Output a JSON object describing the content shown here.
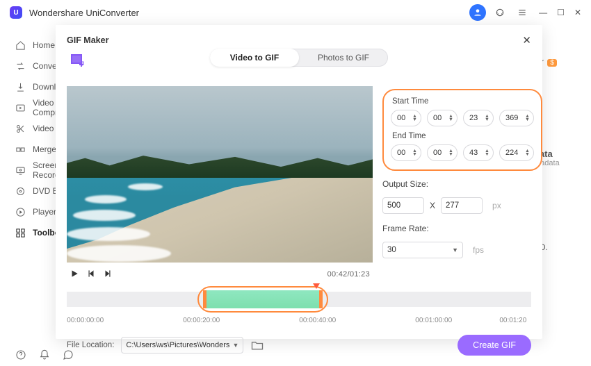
{
  "app": {
    "name": "Wondershare UniConverter"
  },
  "sidebar": {
    "items": [
      {
        "label": "Home"
      },
      {
        "label": "Converter"
      },
      {
        "label": "Downloader"
      },
      {
        "label": "Video Compressor"
      },
      {
        "label": "Video Editor"
      },
      {
        "label": "Merger"
      },
      {
        "label": "Screen Recorder"
      },
      {
        "label": "DVD Burner"
      },
      {
        "label": "Player"
      },
      {
        "label": "Toolbox"
      }
    ]
  },
  "bg": {
    "tor_label": "tor",
    "badge": "$",
    "data_label": "data",
    "etadata_label": "etadata",
    "cd_label": "CD."
  },
  "modal": {
    "title": "GIF Maker",
    "tabs": {
      "video": "Video to GIF",
      "photos": "Photos to GIF"
    },
    "time": "00:42/01:23",
    "start_label": "Start Time",
    "end_label": "End Time",
    "start": {
      "h": "00",
      "m": "00",
      "s": "23",
      "ms": "369"
    },
    "end": {
      "h": "00",
      "m": "00",
      "s": "43",
      "ms": "224"
    },
    "output_label": "Output Size:",
    "output": {
      "w": "500",
      "x": "X",
      "h": "277",
      "unit": "px"
    },
    "frame_label": "Frame Rate:",
    "frame": {
      "value": "30",
      "unit": "fps"
    },
    "ticks": [
      "00:00:00:00",
      "00:00:20:00",
      "00:00:40:00",
      "00:01:00:00",
      "00:01:20"
    ],
    "file_label": "File Location:",
    "file_path": "C:\\Users\\ws\\Pictures\\Wonders",
    "create": "Create GIF"
  }
}
